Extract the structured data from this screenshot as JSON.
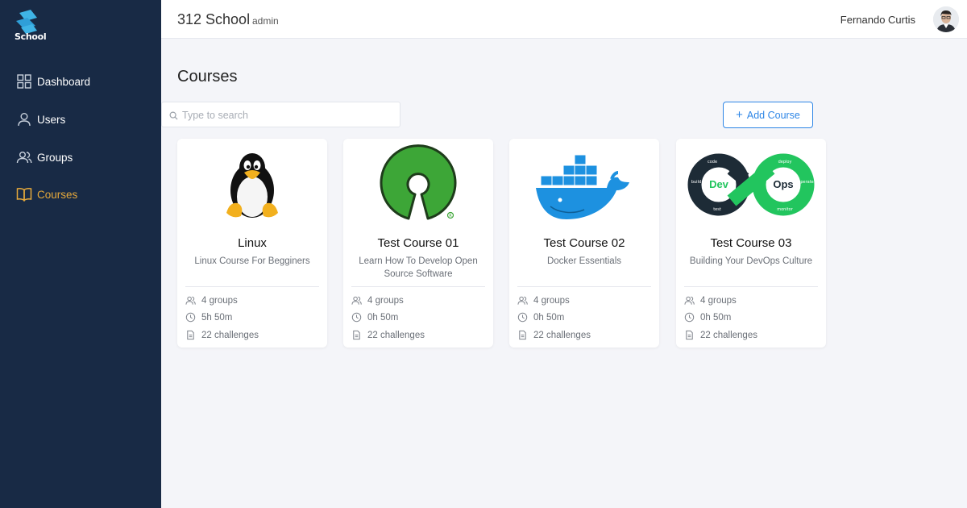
{
  "sidebar": {
    "logo_text": "School",
    "items": [
      {
        "label": "Dashboard",
        "icon": "dashboard-icon",
        "active": false
      },
      {
        "label": "Users",
        "icon": "user-icon",
        "active": false
      },
      {
        "label": "Groups",
        "icon": "group-icon",
        "active": false
      },
      {
        "label": "Courses",
        "icon": "book-icon",
        "active": true
      }
    ]
  },
  "topbar": {
    "title": "312 School",
    "role": "admin",
    "user_name": "Fernando Curtis"
  },
  "main": {
    "page_title": "Courses",
    "search_placeholder": "Type to search",
    "add_button_label": "Add Course",
    "courses": [
      {
        "name": "Linux",
        "description": "Linux Course For Begginers",
        "groups": "4 groups",
        "duration": "5h 50m",
        "challenges": "22 challenges",
        "image": "linux-tux-logo"
      },
      {
        "name": "Test Course 01",
        "description": "Learn How To Develop Open Source Software",
        "groups": "4 groups",
        "duration": "0h 50m",
        "challenges": "22 challenges",
        "image": "open-source-logo"
      },
      {
        "name": "Test Course 02",
        "description": "Docker Essentials",
        "groups": "4 groups",
        "duration": "0h 50m",
        "challenges": "22 challenges",
        "image": "docker-logo"
      },
      {
        "name": "Test Course 03",
        "description": "Building Your DevOps Culture",
        "groups": "4 groups",
        "duration": "0h 50m",
        "challenges": "22 challenges",
        "image": "devops-logo"
      }
    ]
  },
  "colors": {
    "sidebar_bg": "#182a45",
    "active_nav": "#e6a93b",
    "accent": "#2e86e6",
    "page_bg": "#f4f5f9"
  }
}
